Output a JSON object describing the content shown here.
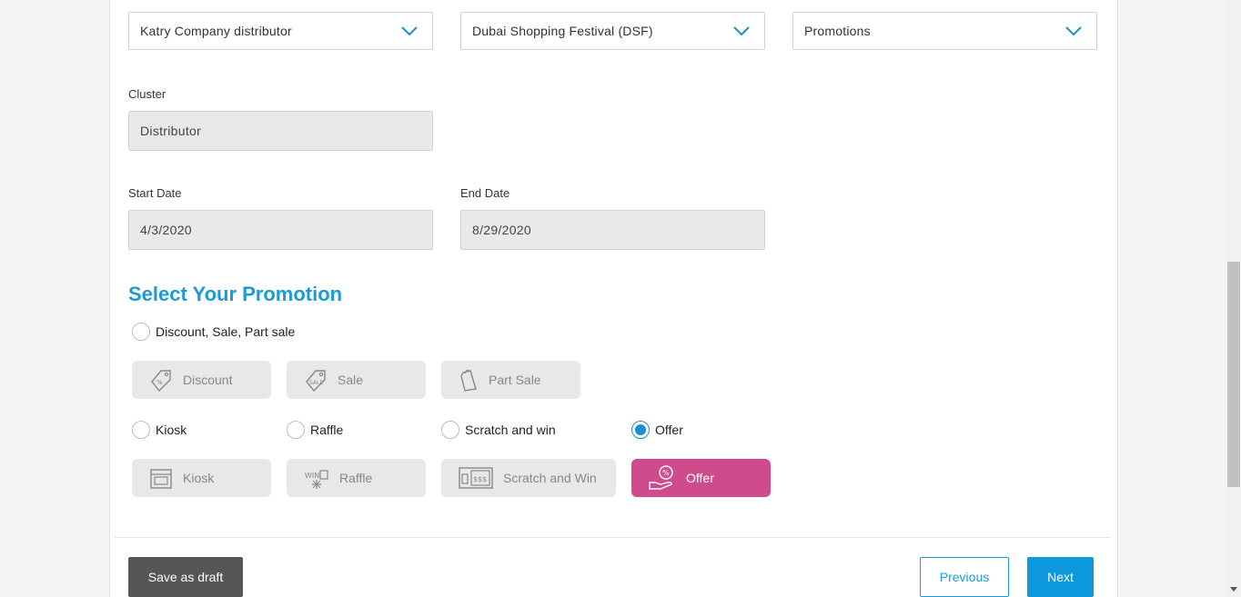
{
  "filters": {
    "company_value": "Katry Company distributor",
    "event_value": "Dubai Shopping Festival (DSF)",
    "campaign_type_value": "Promotions"
  },
  "cluster": {
    "label": "Cluster",
    "value": "Distributor"
  },
  "dates": {
    "start_label": "Start Date",
    "start_value": "4/3/2020",
    "end_label": "End Date",
    "end_value": "8/29/2020"
  },
  "promotion": {
    "title": "Select Your Promotion",
    "group_discount_label": "Discount, Sale, Part sale",
    "tiles_row1": [
      "Discount",
      "Sale",
      "Part Sale"
    ],
    "radios": [
      {
        "label": "Kiosk",
        "checked": false
      },
      {
        "label": "Raffle",
        "checked": false
      },
      {
        "label": "Scratch and win",
        "checked": false
      },
      {
        "label": "Offer",
        "checked": true
      }
    ],
    "tiles_row2": [
      "Kiosk",
      "Raffle",
      "Scratch and Win",
      "Offer"
    ]
  },
  "actions": {
    "save_draft": "Save as draft",
    "previous": "Previous",
    "next": "Next"
  },
  "colors": {
    "accent": "#1a9bd7",
    "offer_active": "#cf4b8c",
    "draft_button": "#565656"
  }
}
